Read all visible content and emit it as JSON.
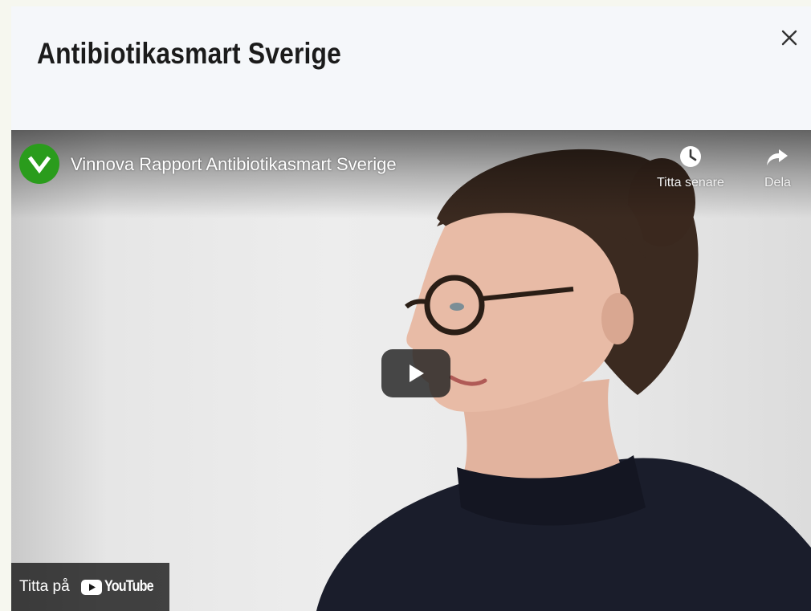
{
  "modal": {
    "title": "Antibiotikasmart Sverige",
    "close_icon": "close-icon"
  },
  "video": {
    "title": "Vinnova Rapport Antibiotikasmart Sverige",
    "channel_logo_icon": "vinnova-v-logo",
    "channel_color": "#2a9c1c",
    "watch_later_label": "Titta senare",
    "watch_later_icon": "clock-icon",
    "share_label": "Dela",
    "share_icon": "share-arrow-icon",
    "play_icon": "play-icon",
    "watch_on_label": "Titta på",
    "youtube_wordmark": "YouTube"
  }
}
